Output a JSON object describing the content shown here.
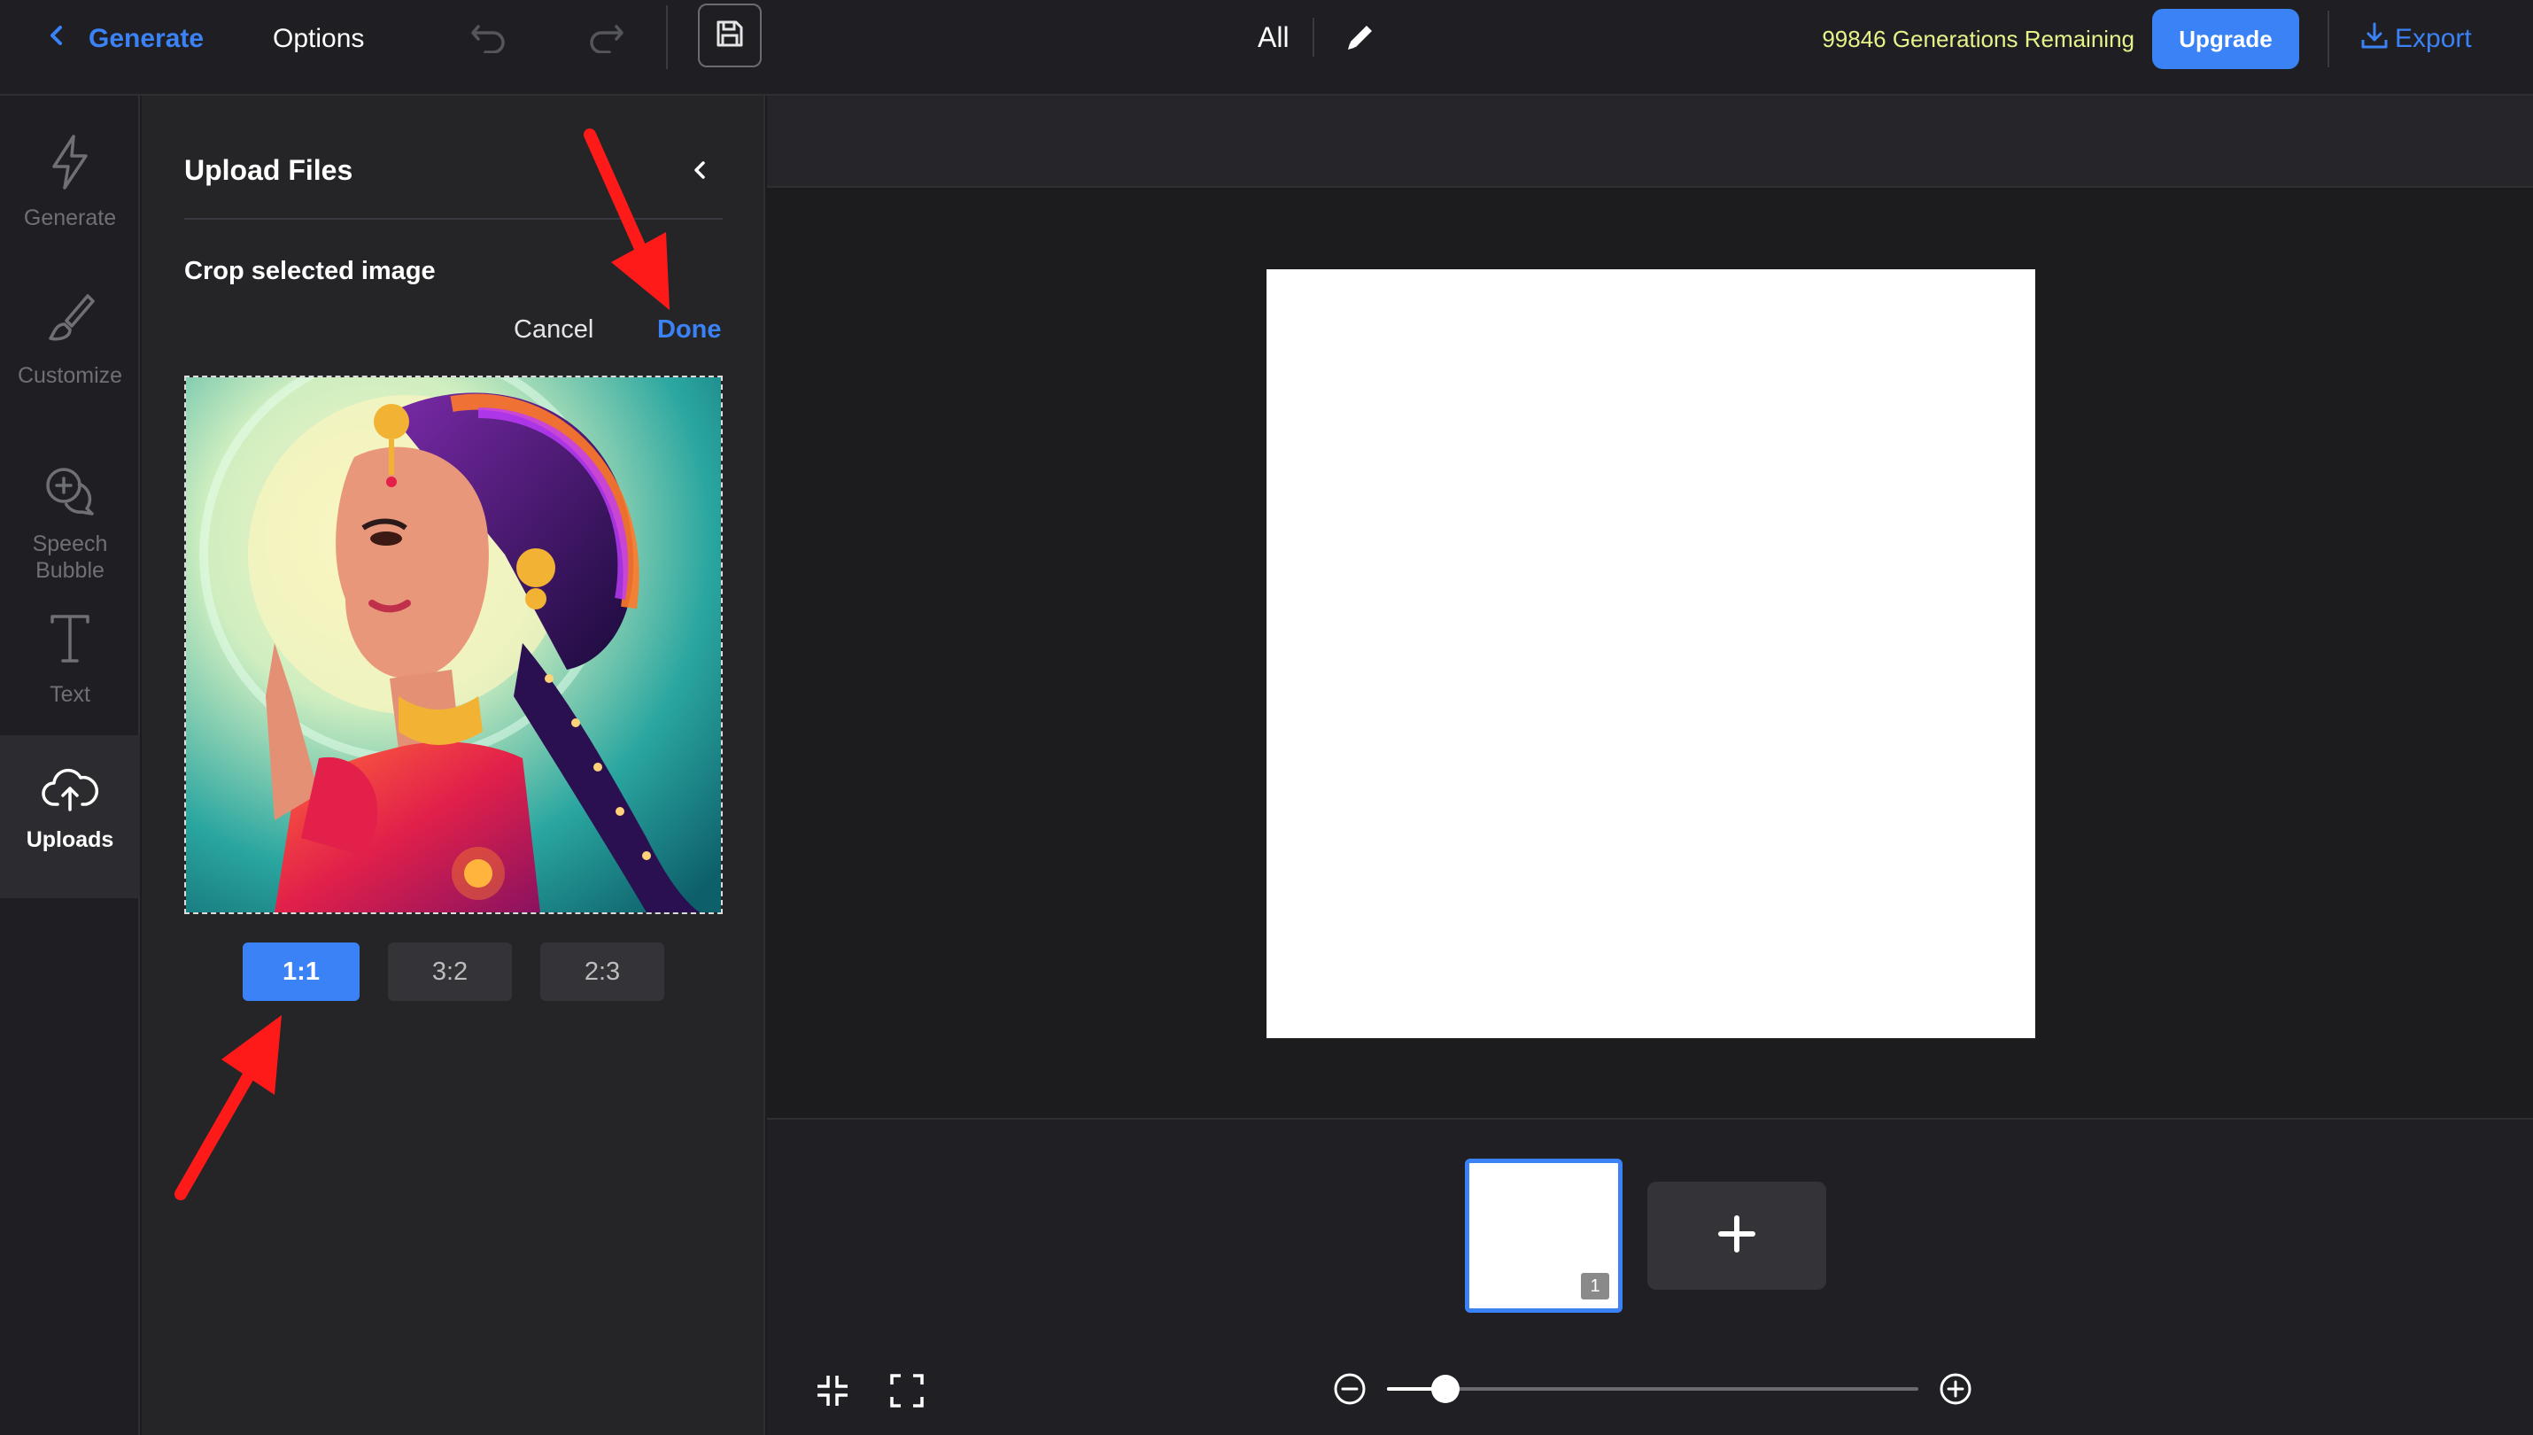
{
  "topbar": {
    "back_label": "Generate",
    "options_label": "Options",
    "filter_label": "All",
    "remaining_text": "99846 Generations Remaining",
    "upgrade_label": "Upgrade",
    "export_label": "Export"
  },
  "rail": {
    "items": [
      {
        "label": "Generate",
        "icon": "bolt-icon"
      },
      {
        "label": "Customize",
        "icon": "brush-icon"
      },
      {
        "label": "Speech\nBubble",
        "icon": "speech-bubble-icon"
      },
      {
        "label": "Text",
        "icon": "text-icon"
      },
      {
        "label": "Uploads",
        "icon": "cloud-upload-icon",
        "active": true
      }
    ]
  },
  "panel": {
    "title": "Upload Files",
    "crop_label": "Crop selected image",
    "cancel_label": "Cancel",
    "done_label": "Done",
    "ratios": [
      {
        "label": "1:1",
        "active": true
      },
      {
        "label": "3:2",
        "active": false
      },
      {
        "label": "2:3",
        "active": false
      }
    ]
  },
  "pages": {
    "thumbnails": [
      {
        "number": "1",
        "selected": true
      }
    ]
  },
  "zoom": {
    "level_fraction": 0.11
  },
  "colors": {
    "accent": "#3b82f6",
    "remaining_text": "#e8f28a",
    "annotation_arrow": "#ff1a1a"
  }
}
